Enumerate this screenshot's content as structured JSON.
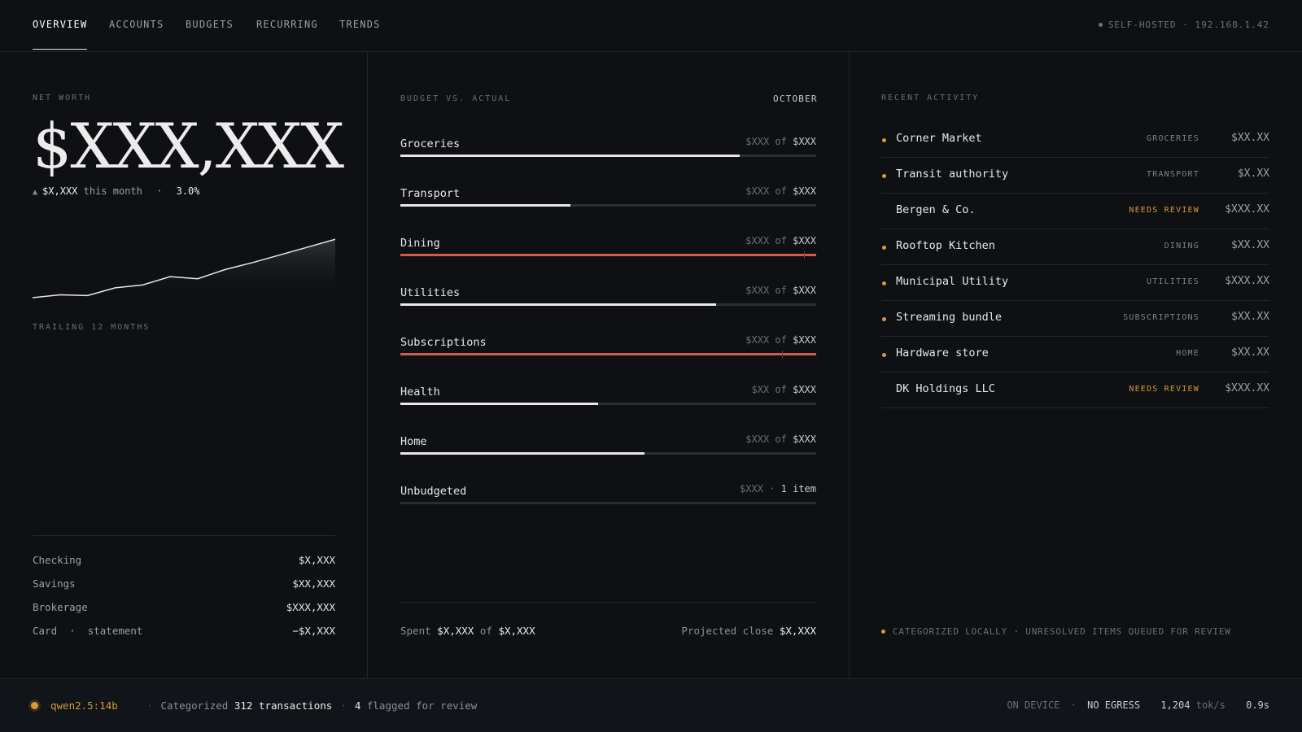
{
  "nav": {
    "tabs": [
      "OVERVIEW",
      "ACCOUNTS",
      "BUDGETS",
      "RECURRING",
      "TRENDS"
    ],
    "active": "OVERVIEW",
    "host": "SELF-HOSTED · 192.168.1.42"
  },
  "net_worth": {
    "label": "NET WORTH",
    "value": "$XXX,XXX",
    "delta_icon": "up-triangle-icon",
    "delta_amount": "$X,XXX",
    "delta_period": "this month",
    "delta_sep": "·",
    "delta_pct": "3.0%",
    "chart_label": "TRAILING 12 MONTHS",
    "trend_values": [
      3,
      7,
      6,
      17,
      21,
      33,
      30,
      43,
      53,
      64,
      75,
      86
    ]
  },
  "accounts": [
    {
      "name": "Checking",
      "value": "$X,XXX"
    },
    {
      "name": "Savings",
      "value": "$XX,XXX"
    },
    {
      "name": "Brokerage",
      "value": "$XXX,XXX"
    },
    {
      "name": "Card  ·  statement",
      "value": "−$X,XXX"
    }
  ],
  "budget": {
    "label": "BUDGET VS. ACTUAL",
    "month": "OCTOBER",
    "items": [
      {
        "name": "Groceries",
        "spent": "$XXX",
        "of": "of",
        "budget": "$XXX",
        "progress": 0.816,
        "over": false
      },
      {
        "name": "Transport",
        "spent": "$XXX",
        "of": "of",
        "budget": "$XXX",
        "progress": 0.409,
        "over": false
      },
      {
        "name": "Dining",
        "spent": "$XXX",
        "of": "of",
        "budget": "$XXX",
        "progress": 1.0,
        "over": true,
        "budget_mark": 0.97
      },
      {
        "name": "Utilities",
        "spent": "$XXX",
        "of": "of",
        "budget": "$XXX",
        "progress": 0.759,
        "over": false
      },
      {
        "name": "Subscriptions",
        "spent": "$XXX",
        "of": "of",
        "budget": "$XXX",
        "progress": 1.0,
        "over": true,
        "budget_mark": 0.917
      },
      {
        "name": "Health",
        "spent": "$XX",
        "of": "of",
        "budget": "$XXX",
        "progress": 0.475,
        "over": false
      },
      {
        "name": "Home",
        "spent": "$XXX",
        "of": "of",
        "budget": "$XXX",
        "progress": 0.587,
        "over": false
      },
      {
        "name": "Unbudgeted",
        "spent": "$XXX",
        "of": "·",
        "budget": "1 item",
        "progress": 0,
        "over": false
      }
    ],
    "footer": {
      "spent_label": "Spent",
      "spent": "$X,XXX",
      "of": "of",
      "total": "$X,XXX",
      "projected_label": "Projected close",
      "projected": "$X,XXX"
    }
  },
  "activity": {
    "label": "RECENT ACTIVITY",
    "items": [
      {
        "name": "Corner Market",
        "category": "GROCERIES",
        "amount": "$XX.XX",
        "dot": true,
        "review": false
      },
      {
        "name": "Transit authority",
        "category": "TRANSPORT",
        "amount": "$X.XX",
        "dot": true,
        "review": false
      },
      {
        "name": "Bergen & Co.",
        "category": "NEEDS REVIEW",
        "amount": "$XXX.XX",
        "dot": false,
        "review": true
      },
      {
        "name": "Rooftop Kitchen",
        "category": "DINING",
        "amount": "$XX.XX",
        "dot": true,
        "review": false
      },
      {
        "name": "Municipal Utility",
        "category": "UTILITIES",
        "amount": "$XXX.XX",
        "dot": true,
        "review": false
      },
      {
        "name": "Streaming bundle",
        "category": "SUBSCRIPTIONS",
        "amount": "$XX.XX",
        "dot": true,
        "review": false
      },
      {
        "name": "Hardware store",
        "category": "HOME",
        "amount": "$XX.XX",
        "dot": true,
        "review": false
      },
      {
        "name": "DK Holdings LLC",
        "category": "NEEDS REVIEW",
        "amount": "$XXX.XX",
        "dot": false,
        "review": true
      }
    ],
    "footer": "CATEGORIZED LOCALLY · UNRESOLVED ITEMS QUEUED FOR REVIEW"
  },
  "status": {
    "model": "qwen2.5:14b",
    "sep": "·",
    "msg_prefix": "Categorized",
    "count": "312 transactions",
    "sep2": "·",
    "flag_count": "4",
    "flag_text": "flagged for review",
    "on_device": "ON DEVICE",
    "sep3": "·",
    "no_egress": "NO EGRESS",
    "speed": "1,204",
    "speed_unit": "tok/s",
    "latency": "0.9s"
  },
  "colors": {
    "accent": "#d49a3a",
    "over_budget": "#d4594b",
    "background": "#0e1013"
  }
}
